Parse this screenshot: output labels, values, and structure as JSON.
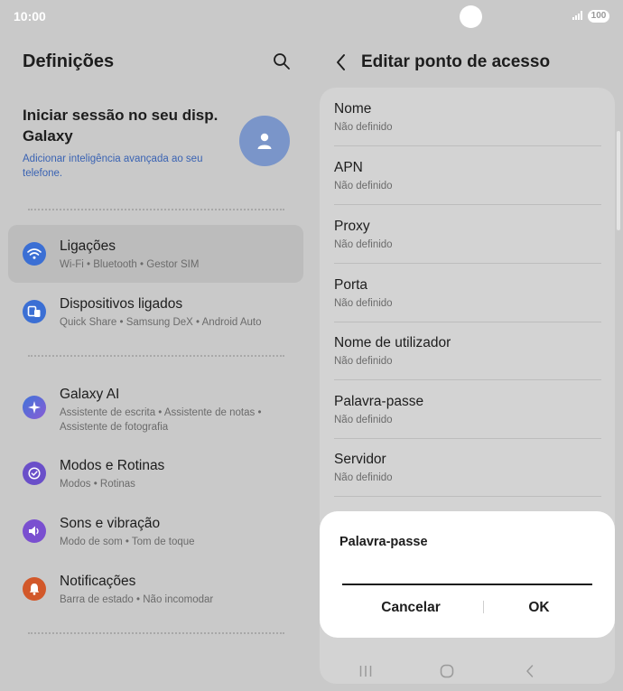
{
  "status_bar": {
    "time": "10:00",
    "battery": "100",
    "icons": [
      "camera-cutout",
      "signal-icon"
    ]
  },
  "left": {
    "title": "Definições",
    "account": {
      "title": "Iniciar sessão no seu disp. Galaxy",
      "subtitle": "Adicionar inteligência avançada ao seu telefone."
    },
    "items": [
      {
        "title": "Ligações",
        "subtitle": "Wi-Fi  •  Bluetooth  •  Gestor SIM",
        "icon": "wifi-icon",
        "color": "#3b6fd4"
      },
      {
        "title": "Dispositivos ligados",
        "subtitle": "Quick Share  •  Samsung DeX  •  Android Auto",
        "icon": "connected-devices-icon",
        "color": "#3b6fd4"
      },
      {
        "title": "Galaxy AI",
        "subtitle": "Assistente de escrita  •  Assistente de notas  •  Assistente de fotografia",
        "icon": "galaxy-ai-icon",
        "color": "#4a78d6"
      },
      {
        "title": "Modos e Rotinas",
        "subtitle": "Modos  •  Rotinas",
        "icon": "modes-routines-icon",
        "color": "#6a4fc9"
      },
      {
        "title": "Sons e vibração",
        "subtitle": "Modo de som  •  Tom de toque",
        "icon": "sound-icon",
        "color": "#7a4fd0"
      },
      {
        "title": "Notificações",
        "subtitle": "Barra de estado  •  Não incomodar",
        "icon": "bell-icon",
        "color": "#d2582a"
      }
    ]
  },
  "right": {
    "title": "Editar ponto de acesso",
    "fields": [
      {
        "label": "Nome",
        "value": "Não definido"
      },
      {
        "label": "APN",
        "value": "Não definido"
      },
      {
        "label": "Proxy",
        "value": "Não definido"
      },
      {
        "label": "Porta",
        "value": "Não definido"
      },
      {
        "label": "Nome de utilizador",
        "value": "Não definido"
      },
      {
        "label": "Palavra-passe",
        "value": "Não definido"
      },
      {
        "label": "Servidor",
        "value": "Não definido"
      }
    ]
  },
  "dialog": {
    "title": "Palavra-passe",
    "input_value": "",
    "cancel_label": "Cancelar",
    "ok_label": "OK"
  },
  "nav_bar": {
    "buttons": [
      "recents-icon",
      "home-icon",
      "back-icon"
    ]
  }
}
